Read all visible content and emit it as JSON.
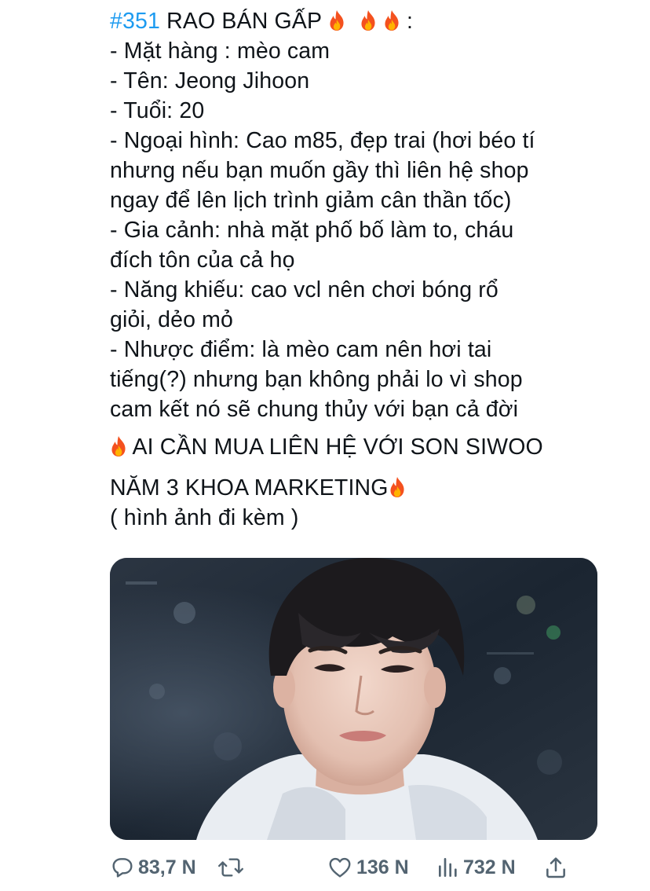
{
  "tweet": {
    "hashtag": "#351",
    "headline": "RAO BÁN GẤP",
    "headline_suffix": ":",
    "lines": [
      "- Mặt hàng : mèo cam",
      "- Tên: Jeong Jihoon",
      "- Tuổi: 20",
      "- Ngoại hình: Cao m85, đẹp trai (hơi béo tí",
      "nhưng nếu bạn muốn gầy thì liên hệ shop",
      "ngay để lên lịch trình giảm cân thần tốc)",
      "- Gia cảnh: nhà mặt phố bố làm to, cháu",
      "đích tôn của cả họ",
      "- Năng khiếu: cao vcl nên chơi bóng rổ",
      "giỏi, dẻo mỏ",
      "- Nhược điểm: là mèo cam nên hơi tai",
      "tiếng(?) nhưng bạn không phải lo vì shop",
      "cam kết nó sẽ chung thủy với bạn cả đời"
    ],
    "cta_line1": "AI CẦN MUA LIÊN HỆ VỚI SON SIWOO",
    "cta_line2": "NĂM 3 KHOA MARKETING",
    "attachment_note": "( hình ảnh đi kèm )",
    "accent_color": "#1d9bf0",
    "emoji": "fire-emoji"
  },
  "media": {
    "icon": "photo-of-young-man-with-dark-hair"
  },
  "actions": {
    "replies": "83,7 N",
    "likes": "136 N",
    "views": "732 N",
    "icons": [
      "reply-icon",
      "retweet-icon",
      "like-icon",
      "views-icon",
      "share-icon"
    ],
    "color": "#536471"
  }
}
